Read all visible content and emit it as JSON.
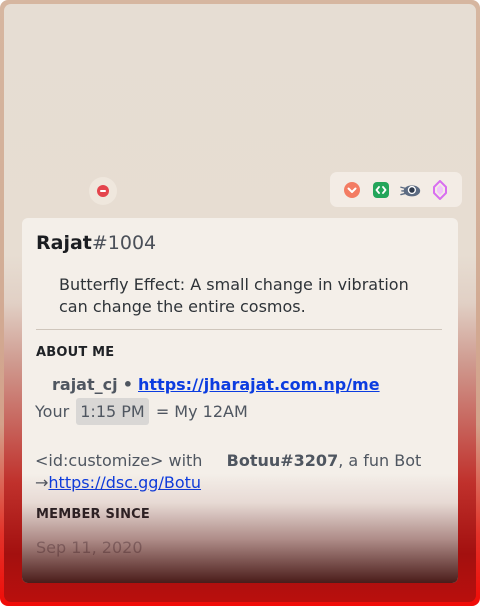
{
  "profile": {
    "username": "Rajat",
    "discriminator": "#1004",
    "status_icon": "do-not-disturb-icon",
    "custom_status": "Butterfly Effect: A small change in vibration can change the entire cosmos."
  },
  "badges": [
    {
      "name": "hypesquad-brilliance-icon",
      "color": "#f37c63"
    },
    {
      "name": "active-developer-icon",
      "color": "#23a55a"
    },
    {
      "name": "early-supporter-icon",
      "color": "#5c6b82"
    },
    {
      "name": "nitro-boost-icon",
      "color": "#d86ef0"
    }
  ],
  "about_me": {
    "header": "ABOUT ME",
    "handle": "rajat_cj",
    "bullet": "•",
    "website": "https://jharajat.com.np/me",
    "time_prefix": "Your",
    "time_value": "1:15 PM",
    "time_suffix": "= My 12AM",
    "customize_tag": "<id:customize> with",
    "bot_name": "Botuu#3207",
    "bot_desc": ", a fun Bot",
    "arrow": "→",
    "bot_link": "https://dsc.gg/Botu"
  },
  "member_since": {
    "header": "MEMBER SINCE",
    "date": "Sep 11, 2020"
  }
}
